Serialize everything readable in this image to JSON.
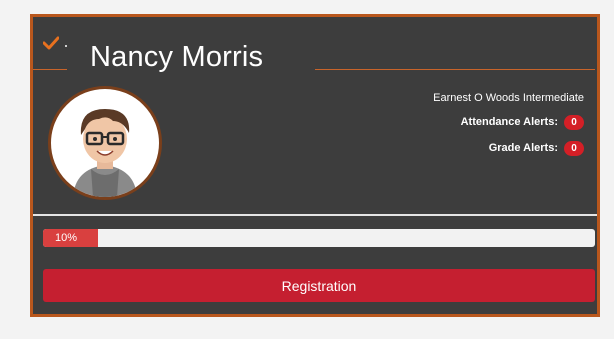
{
  "student": {
    "name": "Nancy Morris",
    "school": "Earnest O Woods Intermediate"
  },
  "alerts": {
    "attendance_label": "Attendance Alerts:",
    "attendance_count": "0",
    "grade_label": "Grade Alerts:",
    "grade_count": "0"
  },
  "progress": {
    "label": "10%",
    "value_percent": 10
  },
  "actions": {
    "registration_label": "Registration"
  },
  "colors": {
    "card_bg": "#3d3d3d",
    "border": "#b9571d",
    "accent_red": "#c51f30",
    "badge_red": "#d41f26",
    "check_orange": "#e8711f"
  },
  "icons": {
    "header": "checkmark-icon",
    "avatar": "student-avatar"
  }
}
